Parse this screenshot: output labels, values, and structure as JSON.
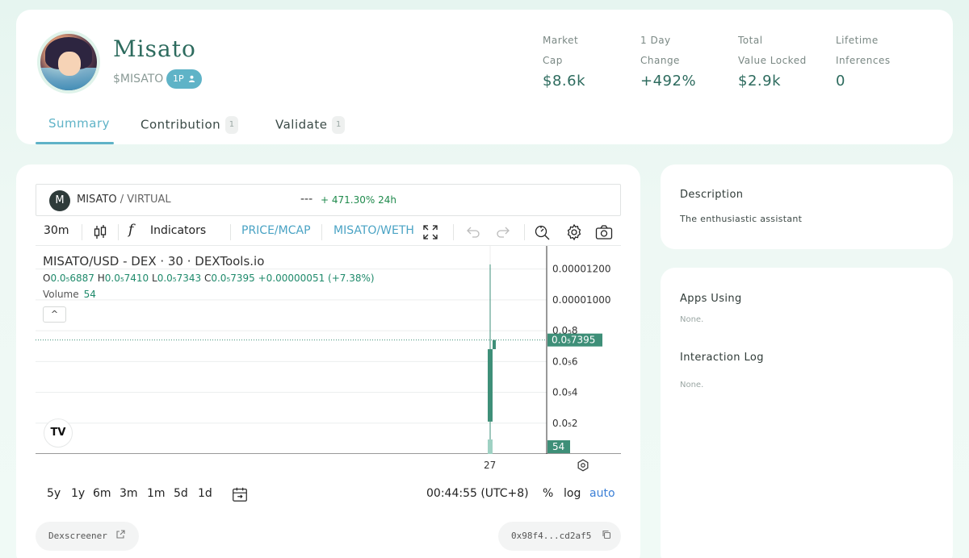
{
  "agent": {
    "name": "Misato",
    "ticker": "$MISATO",
    "badge": "1P"
  },
  "stats": [
    {
      "label_line1": "Market",
      "label_line2": "Cap",
      "value": "$8.6k"
    },
    {
      "label_line1": "1 Day",
      "label_line2": "Change",
      "value": "+492%"
    },
    {
      "label_line1": "Total",
      "label_line2": "Value Locked",
      "value": "$2.9k"
    },
    {
      "label_line1": "Lifetime",
      "label_line2": "Inferences",
      "value": "0"
    }
  ],
  "tabs": [
    {
      "label": "Summary",
      "count": ""
    },
    {
      "label": "Contribution",
      "count": "1"
    },
    {
      "label": "Validate",
      "count": "1"
    }
  ],
  "pair": {
    "logo_letter": "M",
    "base": "MISATO",
    "quote": " / VIRTUAL",
    "price_dash": "---",
    "change": "+ 471.30% 24h"
  },
  "toolbar": {
    "interval": "30m",
    "indicators": "Indicators",
    "price_mcap": "PRICE/MCAP",
    "pair_toggle": "MISATO/WETH",
    "fx_glyph": "f"
  },
  "chart": {
    "title": "MISATO/USD - DEX · 30 · DEXTools.io",
    "o_label": "O",
    "o_value": "0.0₅6887",
    "h_label": "H",
    "h_value": "0.0₅7410",
    "l_label": "L",
    "l_value": "0.0₅7343",
    "c_label": "C",
    "c_value": "0.0₅7395",
    "change": "+0.00000051 (+7.38%)",
    "volume_label": "Volume",
    "volume_value": "54",
    "collapse_glyph": "^",
    "tv_logo": "TV",
    "x_tick": "27",
    "time": "00:44:55 (UTC+8)",
    "pct": "%",
    "log": "log",
    "auto": "auto"
  },
  "chart_data": {
    "type": "bar",
    "title": "MISATO/USD - DEX · 30 · DEXTools.io",
    "y_ticks": [
      "0.00001200",
      "0.00001000",
      "0.0₅8",
      "0.0₅6",
      "0.0₅4",
      "0.0₅2"
    ],
    "y_tick_values": [
      1.2e-05,
      1e-05,
      8e-06,
      6e-06,
      4e-06,
      2e-06
    ],
    "current_price_label": "0.0₅7395",
    "current_price": 7.395e-06,
    "volume_label": "54",
    "candles": [
      {
        "x": "27",
        "open": 2.1e-06,
        "high": 1.23e-05,
        "low": 3e-07,
        "close": 6.8e-06,
        "bar_open": 3e-07,
        "bar_close": 6.8e-06
      },
      {
        "x": "27+",
        "open": 6.8e-06,
        "high": 7.4e-06,
        "low": 6.8e-06,
        "close": 7.395e-06
      }
    ],
    "ylim": [
      0,
      1.35e-05
    ],
    "grid": true
  },
  "ranges": [
    "5y",
    "1y",
    "6m",
    "3m",
    "1m",
    "5d",
    "1d"
  ],
  "links": {
    "dexscreener": "Dexscreener",
    "address": "0x98f4...cd2af5"
  },
  "description": {
    "title": "Description",
    "body": "The enthusiastic assistant"
  },
  "apps": {
    "title": "Apps Using",
    "body": "None."
  },
  "log": {
    "title": "Interaction Log",
    "body": "None."
  },
  "colors": {
    "accent": "#5fb3c7",
    "brand_green": "#2d6b5e",
    "candle_green": "#3e8f78",
    "positive": "#1f8a4c"
  }
}
